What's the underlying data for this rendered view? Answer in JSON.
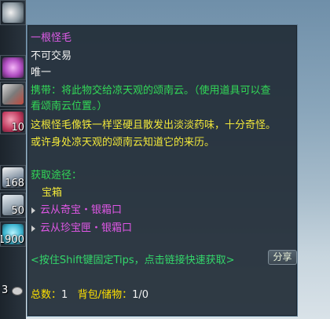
{
  "inventory": {
    "counts": [
      "10",
      "168",
      "50",
      "1900",
      "3"
    ]
  },
  "tooltip": {
    "item_name": "一根怪毛",
    "trade": "不可交易",
    "unique": "唯一",
    "carry_line1": "携带：将此物交给凉天观的颂南云。（使用道具可以查",
    "carry_line2": "看颂南云位置。）",
    "desc_line1": "这根怪毛像铁一样坚硬且散发出淡淡药味，十分奇怪。",
    "desc_line2": "或许身处凉天观的颂南云知道它的来历。",
    "source_title": "获取途径：",
    "source_category": "宝箱",
    "sources": [
      "云从奇宝・银霜口",
      "云从珍宝匣・银霜口"
    ],
    "hint": "<按住Shift键固定Tips，点击链接快速获取>",
    "share_label": "分享",
    "total_label": "总数：",
    "total_value": "1",
    "bag_label": "背包/储物：",
    "bag_value": "1/0"
  }
}
